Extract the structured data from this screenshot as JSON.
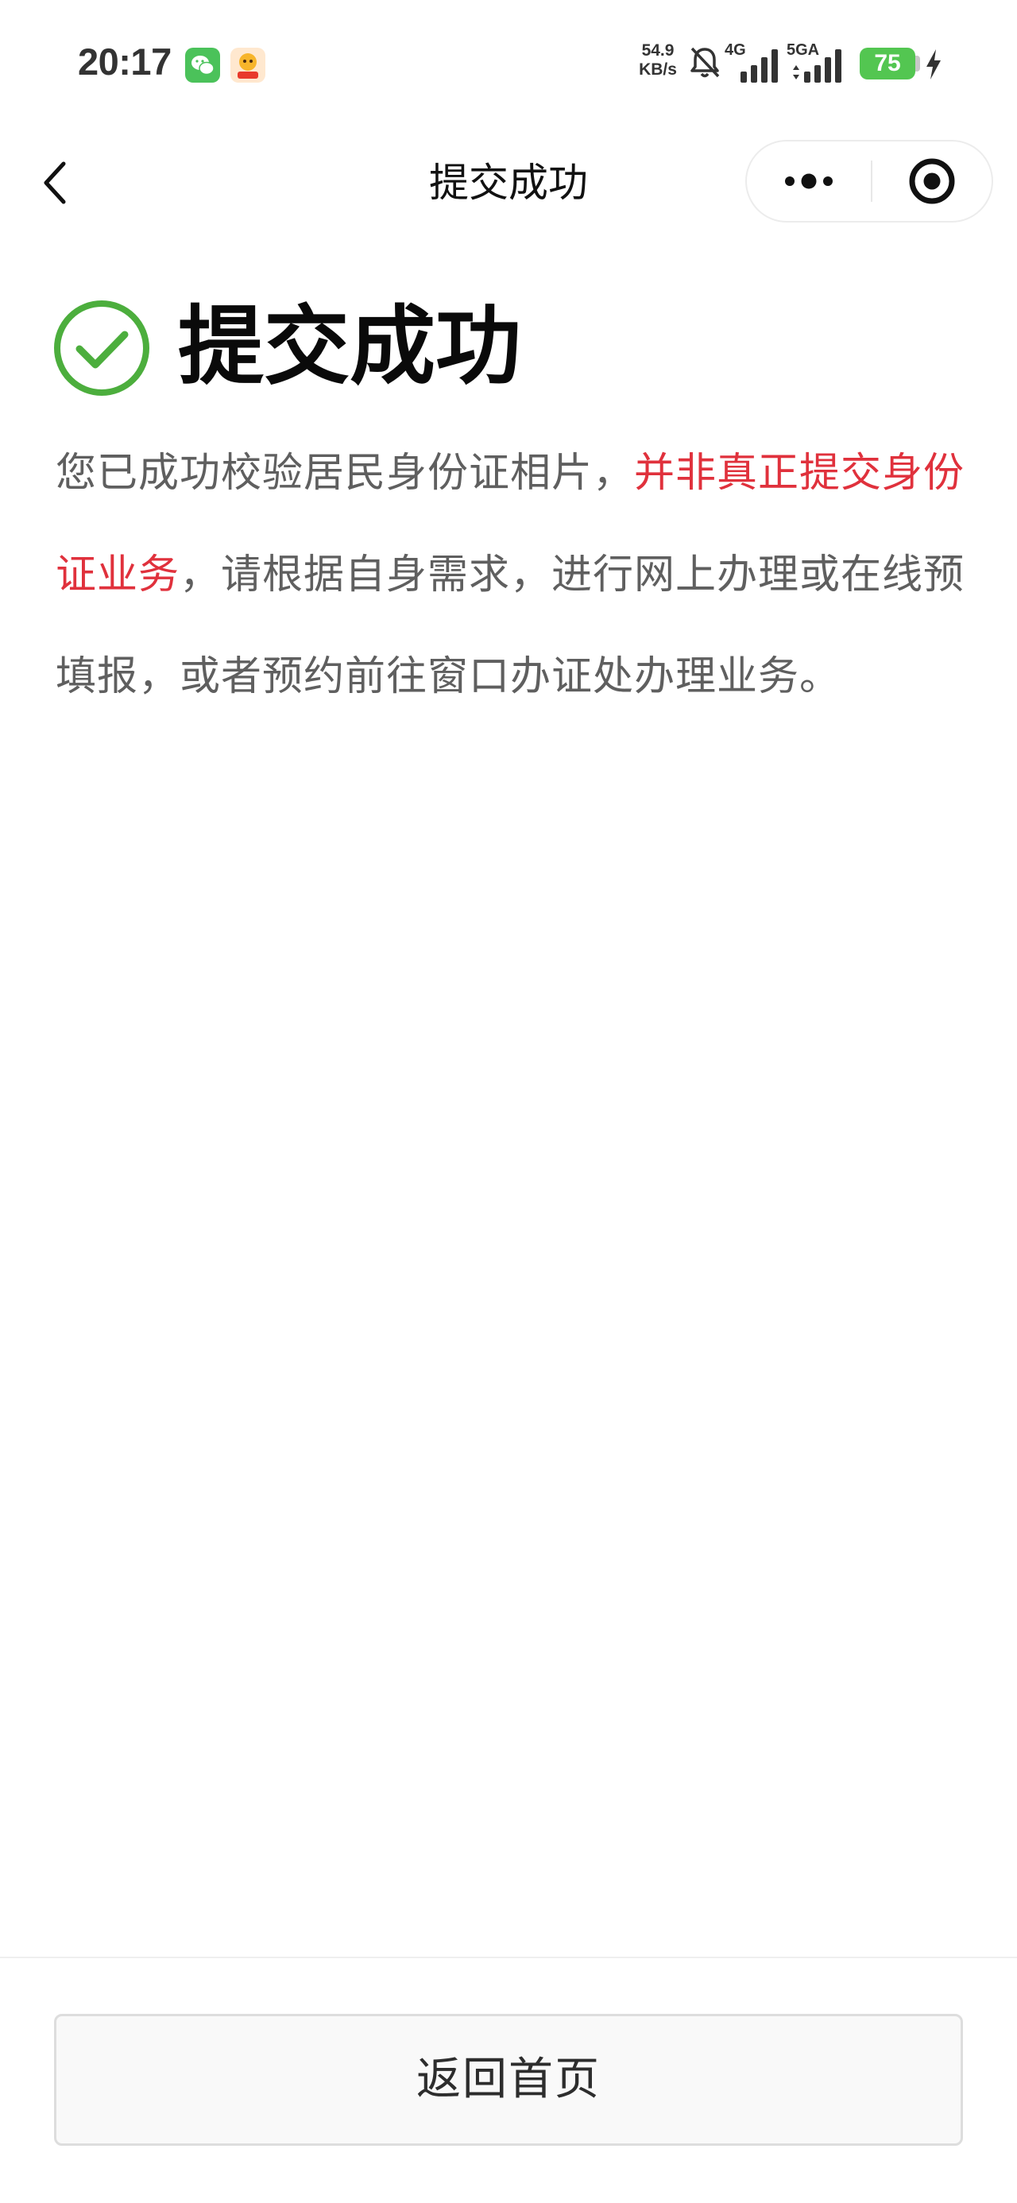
{
  "status_bar": {
    "time": "20:17",
    "net_speed_value": "54.9",
    "net_speed_unit": "KB/s",
    "signal_1_label": "4G",
    "signal_2_label": "5GA",
    "battery_level": "75",
    "icons": [
      "wechat-app-icon",
      "taobao-app-icon",
      "mute-bell-icon",
      "signal-4g-icon",
      "signal-5ga-icon",
      "battery-icon",
      "charging-bolt-icon"
    ]
  },
  "nav": {
    "title": "提交成功",
    "icons": [
      "back-chevron-icon",
      "more-dots-icon",
      "close-target-icon"
    ]
  },
  "result": {
    "title": "提交成功",
    "icon": "check-circle-icon",
    "desc_before": "您已成功校验居民身份证相片，",
    "desc_emphasis": "并非真正提交身份证业务",
    "desc_after": "，请根据自身需求，进行网上办理或在线预填报，或者预约前往窗口办证处办理业务。",
    "emphasis_color": "#e0313c",
    "success_color": "#4cae3d"
  },
  "footer": {
    "home_button_label": "返回首页"
  }
}
